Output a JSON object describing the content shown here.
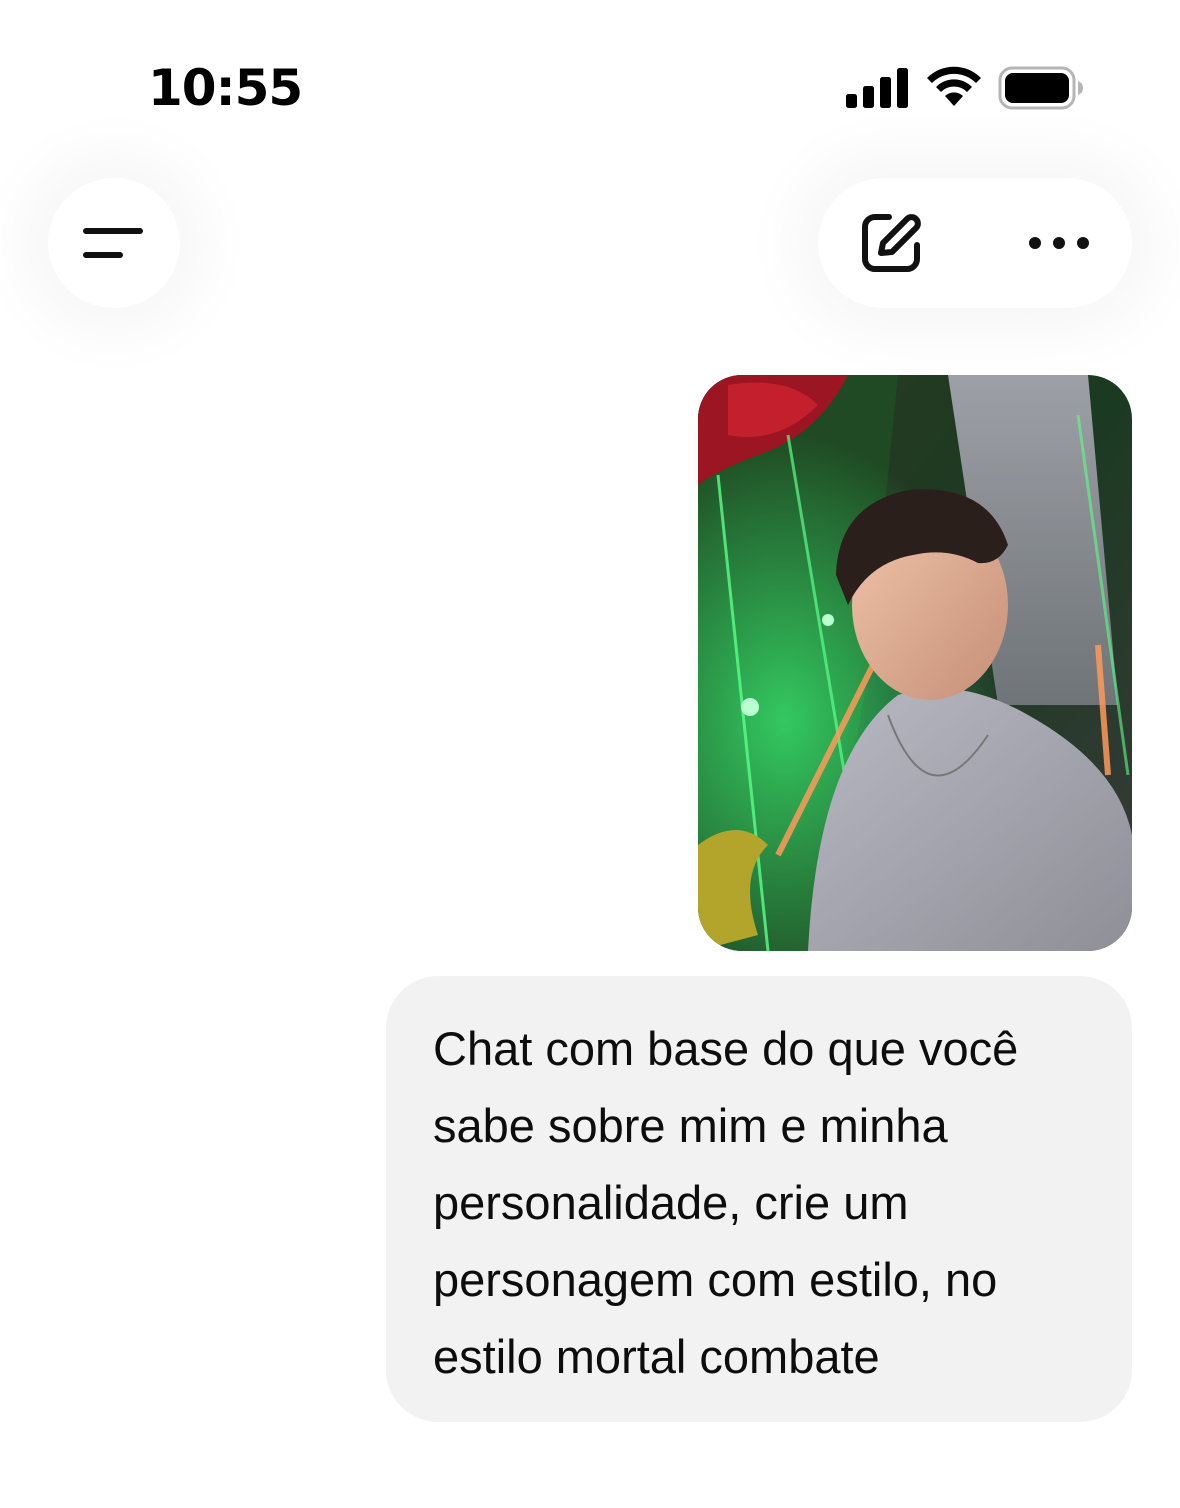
{
  "status_bar": {
    "time": "10:55",
    "icons": [
      "signal-icon",
      "wifi-icon",
      "battery-icon"
    ]
  },
  "header": {
    "menu_icon": "menu-icon",
    "new_chat_icon": "edit-icon",
    "more_icon": "more-icon"
  },
  "conversation": {
    "user_image": {
      "description": "photo-attachment"
    },
    "user_message": "Chat com base do que você sabe sobre mim e minha personalidade, crie um personagem com estilo, no estilo mortal combate"
  },
  "colors": {
    "bubble_background": "#f2f2f2",
    "text": "#0d0d0d",
    "page_background": "#ffffff"
  }
}
